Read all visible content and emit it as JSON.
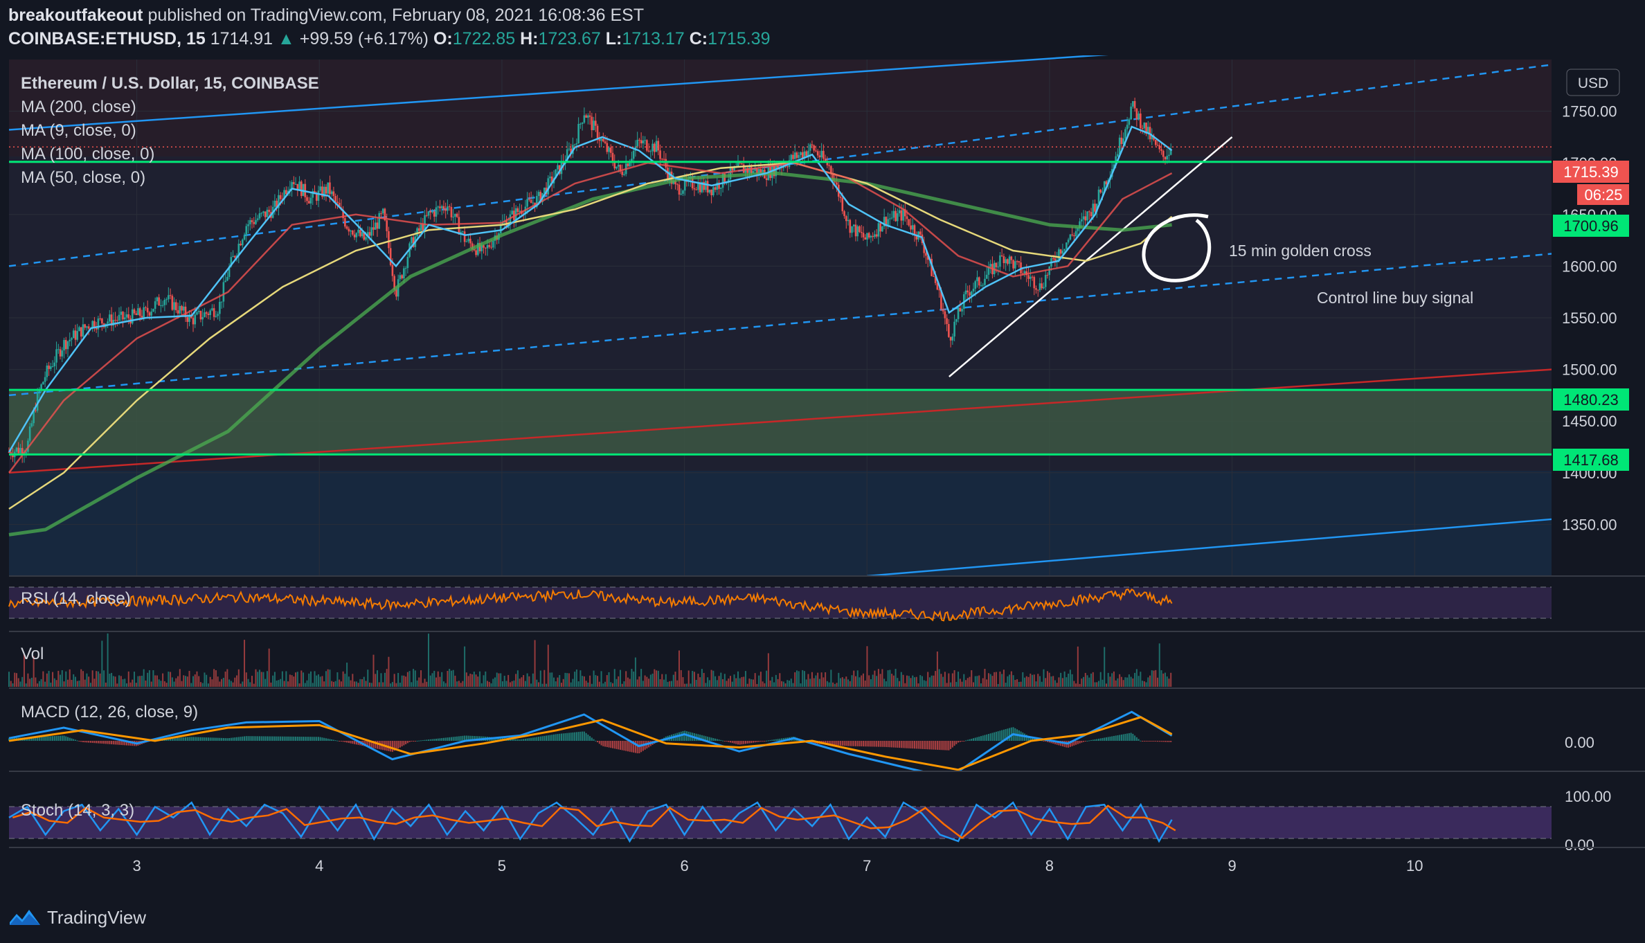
{
  "header": {
    "author": "breakoutfakeout",
    "published_text": "published on TradingView.com, February 08, 2021 16:08:36 EST",
    "symbol": "COINBASE:ETHUSD, 15",
    "last": "1714.91",
    "up_arrow": "▲",
    "change": "+99.59 (+6.17%)",
    "o_label": "O:",
    "o": "1722.85",
    "h_label": "H:",
    "h": "1723.67",
    "l_label": "L:",
    "l": "1713.17",
    "c_label": "C:",
    "c": "1715.39"
  },
  "legend": {
    "title": "Ethereum / U.S. Dollar, 15, COINBASE",
    "ma200": "MA (200, close)",
    "ma9": "MA (9, close, 0)",
    "ma100": "MA (100, close, 0)",
    "ma50": "MA (50, close, 0)"
  },
  "currency_button": "USD",
  "annotations": {
    "golden_cross": "15 min golden cross",
    "control_line": "Control line buy signal"
  },
  "price_tags": {
    "last": "1715.39",
    "countdown": "06:25",
    "level_high": "1700.96",
    "zone_top": "1480.23",
    "zone_bottom": "1417.68"
  },
  "panes": {
    "rsi": "RSI (14, close)",
    "vol": "Vol",
    "macd": "MACD (12, 26, close, 9)",
    "stoch": "Stoch (14, 3, 3)"
  },
  "macd_axis": [
    "0.00"
  ],
  "stoch_axis": [
    "100.00",
    "0.00"
  ],
  "footer": {
    "brand": "TradingView"
  },
  "colors": {
    "background": "#131722",
    "candle_up": "#26a69a",
    "candle_down": "#ef5350",
    "ma9": "#4fc3f7",
    "ma50": "#ef5350",
    "ma100": "#e6d87a",
    "ma200": "#4caf50",
    "support_zone": "#2e7d32",
    "level_line": "#00e676",
    "channel": "#2196f3",
    "trend_red": "#c62828"
  },
  "chart_data": {
    "type": "candlestick",
    "title": "Ethereum / U.S. Dollar, 15, COINBASE",
    "x_ticks": [
      "3",
      "4",
      "5",
      "6",
      "7",
      "8",
      "9",
      "10"
    ],
    "y_ticks": [
      "1750.00",
      "1700.00",
      "1650.00",
      "1600.00",
      "1550.00",
      "1500.00",
      "1450.00",
      "1400.00",
      "1350.00"
    ],
    "ylim": [
      1300,
      1800
    ],
    "xlim": [
      2.3,
      10.75
    ],
    "price_path": [
      [
        2.3,
        1420
      ],
      [
        2.4,
        1425
      ],
      [
        2.45,
        1470
      ],
      [
        2.5,
        1495
      ],
      [
        2.6,
        1525
      ],
      [
        2.75,
        1545
      ],
      [
        2.95,
        1550
      ],
      [
        3.05,
        1555
      ],
      [
        3.15,
        1570
      ],
      [
        3.3,
        1548
      ],
      [
        3.45,
        1560
      ],
      [
        3.5,
        1595
      ],
      [
        3.6,
        1640
      ],
      [
        3.75,
        1655
      ],
      [
        3.85,
        1685
      ],
      [
        3.95,
        1665
      ],
      [
        4.05,
        1675
      ],
      [
        4.15,
        1640
      ],
      [
        4.25,
        1625
      ],
      [
        4.35,
        1650
      ],
      [
        4.42,
        1575
      ],
      [
        4.5,
        1620
      ],
      [
        4.6,
        1650
      ],
      [
        4.7,
        1660
      ],
      [
        4.8,
        1625
      ],
      [
        4.9,
        1612
      ],
      [
        5.0,
        1640
      ],
      [
        5.1,
        1655
      ],
      [
        5.2,
        1665
      ],
      [
        5.3,
        1690
      ],
      [
        5.4,
        1720
      ],
      [
        5.45,
        1750
      ],
      [
        5.55,
        1720
      ],
      [
        5.65,
        1690
      ],
      [
        5.75,
        1720
      ],
      [
        5.85,
        1715
      ],
      [
        5.95,
        1675
      ],
      [
        6.05,
        1680
      ],
      [
        6.15,
        1675
      ],
      [
        6.3,
        1695
      ],
      [
        6.45,
        1690
      ],
      [
        6.55,
        1700
      ],
      [
        6.7,
        1715
      ],
      [
        6.8,
        1695
      ],
      [
        6.9,
        1640
      ],
      [
        7.0,
        1625
      ],
      [
        7.1,
        1645
      ],
      [
        7.2,
        1650
      ],
      [
        7.3,
        1625
      ],
      [
        7.4,
        1570
      ],
      [
        7.45,
        1530
      ],
      [
        7.55,
        1575
      ],
      [
        7.65,
        1590
      ],
      [
        7.75,
        1610
      ],
      [
        7.85,
        1595
      ],
      [
        7.95,
        1580
      ],
      [
        8.05,
        1615
      ],
      [
        8.15,
        1635
      ],
      [
        8.25,
        1660
      ],
      [
        8.35,
        1700
      ],
      [
        8.45,
        1755
      ],
      [
        8.55,
        1725
      ],
      [
        8.62,
        1705
      ],
      [
        8.67,
        1715
      ]
    ],
    "ma9_path": [
      [
        2.3,
        1420
      ],
      [
        2.5,
        1480
      ],
      [
        2.75,
        1540
      ],
      [
        3.05,
        1550
      ],
      [
        3.3,
        1552
      ],
      [
        3.6,
        1620
      ],
      [
        3.85,
        1675
      ],
      [
        4.05,
        1668
      ],
      [
        4.25,
        1632
      ],
      [
        4.42,
        1600
      ],
      [
        4.6,
        1640
      ],
      [
        4.8,
        1630
      ],
      [
        5.0,
        1635
      ],
      [
        5.2,
        1660
      ],
      [
        5.4,
        1715
      ],
      [
        5.55,
        1725
      ],
      [
        5.75,
        1712
      ],
      [
        5.95,
        1685
      ],
      [
        6.15,
        1678
      ],
      [
        6.45,
        1690
      ],
      [
        6.7,
        1708
      ],
      [
        6.9,
        1660
      ],
      [
        7.1,
        1640
      ],
      [
        7.3,
        1628
      ],
      [
        7.45,
        1555
      ],
      [
        7.65,
        1580
      ],
      [
        7.85,
        1598
      ],
      [
        8.05,
        1605
      ],
      [
        8.25,
        1650
      ],
      [
        8.45,
        1735
      ],
      [
        8.55,
        1728
      ],
      [
        8.67,
        1712
      ]
    ],
    "ma50_path": [
      [
        2.3,
        1400
      ],
      [
        2.6,
        1470
      ],
      [
        3.0,
        1530
      ],
      [
        3.5,
        1575
      ],
      [
        3.85,
        1640
      ],
      [
        4.2,
        1650
      ],
      [
        4.6,
        1640
      ],
      [
        5.0,
        1642
      ],
      [
        5.4,
        1680
      ],
      [
        5.8,
        1700
      ],
      [
        6.2,
        1690
      ],
      [
        6.6,
        1700
      ],
      [
        6.9,
        1685
      ],
      [
        7.2,
        1655
      ],
      [
        7.5,
        1610
      ],
      [
        7.8,
        1590
      ],
      [
        8.1,
        1600
      ],
      [
        8.4,
        1665
      ],
      [
        8.67,
        1690
      ]
    ],
    "ma100_path": [
      [
        2.3,
        1365
      ],
      [
        2.6,
        1400
      ],
      [
        3.0,
        1470
      ],
      [
        3.4,
        1530
      ],
      [
        3.8,
        1580
      ],
      [
        4.2,
        1615
      ],
      [
        4.6,
        1635
      ],
      [
        5.0,
        1640
      ],
      [
        5.4,
        1655
      ],
      [
        5.8,
        1680
      ],
      [
        6.2,
        1695
      ],
      [
        6.6,
        1700
      ],
      [
        7.0,
        1680
      ],
      [
        7.4,
        1645
      ],
      [
        7.8,
        1615
      ],
      [
        8.2,
        1605
      ],
      [
        8.5,
        1622
      ],
      [
        8.67,
        1648
      ]
    ],
    "ma200_path": [
      [
        2.3,
        1340
      ],
      [
        2.5,
        1345
      ],
      [
        3.0,
        1395
      ],
      [
        3.5,
        1440
      ],
      [
        4.0,
        1520
      ],
      [
        4.5,
        1590
      ],
      [
        5.0,
        1630
      ],
      [
        5.5,
        1665
      ],
      [
        6.0,
        1685
      ],
      [
        6.5,
        1690
      ],
      [
        7.0,
        1680
      ],
      [
        7.5,
        1660
      ],
      [
        8.0,
        1640
      ],
      [
        8.4,
        1635
      ],
      [
        8.67,
        1640
      ]
    ],
    "horizontal_levels": [
      1700.96,
      1480.23,
      1417.68
    ],
    "support_zone": [
      1417.68,
      1480.23
    ],
    "lines": [
      {
        "name": "channel_upper",
        "from": [
          2.3,
          1732
        ],
        "to": [
          8.5,
          1807
        ],
        "style": "solid"
      },
      {
        "name": "channel_lower",
        "from": [
          7.0,
          1300
        ],
        "to": [
          10.75,
          1355
        ],
        "style": "solid"
      },
      {
        "name": "channel_mid_upper",
        "from": [
          2.3,
          1600
        ],
        "to": [
          10.75,
          1795
        ],
        "style": "dashed"
      },
      {
        "name": "channel_mid_lower",
        "from": [
          2.3,
          1475
        ],
        "to": [
          10.75,
          1612
        ],
        "style": "dashed"
      },
      {
        "name": "trend_red",
        "from": [
          2.3,
          1400
        ],
        "to": [
          10.75,
          1500
        ],
        "style": "solid"
      },
      {
        "name": "control_line",
        "from": [
          7.45,
          1493
        ],
        "to": [
          9.0,
          1725
        ],
        "style": "solid"
      }
    ],
    "rsi_path": [
      [
        2.3,
        50
      ],
      [
        3,
        55
      ],
      [
        3.6,
        62
      ],
      [
        4.4,
        48
      ],
      [
        5.4,
        68
      ],
      [
        5.9,
        52
      ],
      [
        6.4,
        60
      ],
      [
        6.9,
        35
      ],
      [
        7.45,
        28
      ],
      [
        8.0,
        50
      ],
      [
        8.45,
        70
      ],
      [
        8.67,
        52
      ]
    ],
    "macd_path": [
      [
        2.3,
        2
      ],
      [
        2.6,
        10
      ],
      [
        3.0,
        -2
      ],
      [
        3.3,
        8
      ],
      [
        3.6,
        14
      ],
      [
        4.0,
        15
      ],
      [
        4.4,
        -14
      ],
      [
        4.8,
        0
      ],
      [
        5.1,
        4
      ],
      [
        5.45,
        20
      ],
      [
        5.75,
        -4
      ],
      [
        6.0,
        5
      ],
      [
        6.3,
        -8
      ],
      [
        6.6,
        2
      ],
      [
        6.9,
        -10
      ],
      [
        7.2,
        -20
      ],
      [
        7.45,
        -28
      ],
      [
        7.8,
        5
      ],
      [
        8.1,
        -2
      ],
      [
        8.45,
        22
      ],
      [
        8.67,
        4
      ]
    ],
    "signal_path": [
      [
        2.3,
        0
      ],
      [
        2.7,
        8
      ],
      [
        3.1,
        0
      ],
      [
        3.5,
        10
      ],
      [
        4.0,
        12
      ],
      [
        4.5,
        -10
      ],
      [
        4.9,
        -2
      ],
      [
        5.3,
        8
      ],
      [
        5.55,
        16
      ],
      [
        5.9,
        -2
      ],
      [
        6.3,
        -5
      ],
      [
        6.7,
        0
      ],
      [
        7.1,
        -12
      ],
      [
        7.5,
        -22
      ],
      [
        7.9,
        0
      ],
      [
        8.2,
        5
      ],
      [
        8.5,
        18
      ],
      [
        8.67,
        5
      ]
    ],
    "stoch_path": [
      [
        2.3,
        60
      ],
      [
        2.4,
        85
      ],
      [
        2.5,
        20
      ],
      [
        2.6,
        75
      ],
      [
        2.7,
        90
      ],
      [
        2.8,
        30
      ],
      [
        2.9,
        80
      ],
      [
        3.0,
        20
      ],
      [
        3.1,
        85
      ],
      [
        3.2,
        60
      ],
      [
        3.3,
        95
      ],
      [
        3.4,
        20
      ],
      [
        3.5,
        80
      ],
      [
        3.6,
        40
      ],
      [
        3.7,
        90
      ],
      [
        3.8,
        70
      ],
      [
        3.9,
        15
      ],
      [
        4.0,
        85
      ],
      [
        4.1,
        30
      ],
      [
        4.2,
        90
      ],
      [
        4.3,
        10
      ],
      [
        4.4,
        80
      ],
      [
        4.5,
        40
      ],
      [
        4.6,
        90
      ],
      [
        4.7,
        20
      ],
      [
        4.8,
        75
      ],
      [
        4.9,
        30
      ],
      [
        5.0,
        85
      ],
      [
        5.1,
        10
      ],
      [
        5.2,
        70
      ],
      [
        5.3,
        95
      ],
      [
        5.4,
        60
      ],
      [
        5.5,
        20
      ],
      [
        5.6,
        80
      ],
      [
        5.7,
        5
      ],
      [
        5.8,
        75
      ],
      [
        5.9,
        90
      ],
      [
        6.0,
        20
      ],
      [
        6.1,
        85
      ],
      [
        6.2,
        25
      ],
      [
        6.3,
        70
      ],
      [
        6.4,
        95
      ],
      [
        6.5,
        30
      ],
      [
        6.6,
        80
      ],
      [
        6.7,
        40
      ],
      [
        6.8,
        90
      ],
      [
        6.9,
        10
      ],
      [
        7.0,
        60
      ],
      [
        7.1,
        15
      ],
      [
        7.2,
        95
      ],
      [
        7.3,
        70
      ],
      [
        7.4,
        20
      ],
      [
        7.5,
        5
      ],
      [
        7.6,
        90
      ],
      [
        7.7,
        60
      ],
      [
        7.8,
        95
      ],
      [
        7.9,
        20
      ],
      [
        8.0,
        80
      ],
      [
        8.1,
        10
      ],
      [
        8.2,
        85
      ],
      [
        8.3,
        90
      ],
      [
        8.4,
        30
      ],
      [
        8.5,
        90
      ],
      [
        8.6,
        5
      ],
      [
        8.67,
        55
      ]
    ]
  }
}
